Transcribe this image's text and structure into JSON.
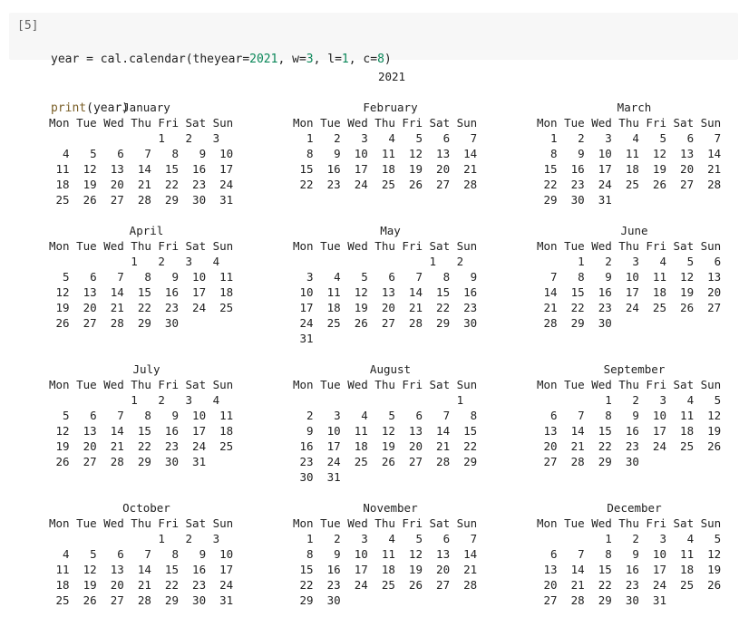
{
  "cell": {
    "prompt": "[5]",
    "line1": [
      {
        "t": "year = cal.calendar(theyear=",
        "c": ""
      },
      {
        "t": "2021",
        "c": "num"
      },
      {
        "t": ", w=",
        "c": ""
      },
      {
        "t": "3",
        "c": "num"
      },
      {
        "t": ", l=",
        "c": ""
      },
      {
        "t": "1",
        "c": "num"
      },
      {
        "t": ", c=",
        "c": ""
      },
      {
        "t": "8",
        "c": "num"
      },
      {
        "t": ")",
        "c": ""
      }
    ],
    "line2": [
      {
        "t": "print",
        "c": "kw"
      },
      {
        "t": "(year)",
        "c": ""
      }
    ]
  },
  "output": {
    "year_title": "2021",
    "weekday_header": "Mon Tue Wed Thu Fri Sat Sun",
    "months": [
      {
        "name": "January",
        "weeks": [
          "                1   2   3",
          "  4   5   6   7   8   9  10",
          " 11  12  13  14  15  16  17",
          " 18  19  20  21  22  23  24",
          " 25  26  27  28  29  30  31"
        ]
      },
      {
        "name": "February",
        "weeks": [
          "  1   2   3   4   5   6   7",
          "  8   9  10  11  12  13  14",
          " 15  16  17  18  19  20  21",
          " 22  23  24  25  26  27  28"
        ]
      },
      {
        "name": "March",
        "weeks": [
          "  1   2   3   4   5   6   7",
          "  8   9  10  11  12  13  14",
          " 15  16  17  18  19  20  21",
          " 22  23  24  25  26  27  28",
          " 29  30  31"
        ]
      },
      {
        "name": "April",
        "weeks": [
          "            1   2   3   4",
          "  5   6   7   8   9  10  11",
          " 12  13  14  15  16  17  18",
          " 19  20  21  22  23  24  25",
          " 26  27  28  29  30"
        ]
      },
      {
        "name": "May",
        "weeks": [
          "                    1   2",
          "  3   4   5   6   7   8   9",
          " 10  11  12  13  14  15  16",
          " 17  18  19  20  21  22  23",
          " 24  25  26  27  28  29  30",
          " 31"
        ]
      },
      {
        "name": "June",
        "weeks": [
          "      1   2   3   4   5   6",
          "  7   8   9  10  11  12  13",
          " 14  15  16  17  18  19  20",
          " 21  22  23  24  25  26  27",
          " 28  29  30"
        ]
      },
      {
        "name": "July",
        "weeks": [
          "            1   2   3   4",
          "  5   6   7   8   9  10  11",
          " 12  13  14  15  16  17  18",
          " 19  20  21  22  23  24  25",
          " 26  27  28  29  30  31"
        ]
      },
      {
        "name": "August",
        "weeks": [
          "                        1",
          "  2   3   4   5   6   7   8",
          "  9  10  11  12  13  14  15",
          " 16  17  18  19  20  21  22",
          " 23  24  25  26  27  28  29",
          " 30  31"
        ]
      },
      {
        "name": "September",
        "weeks": [
          "          1   2   3   4   5",
          "  6   7   8   9  10  11  12",
          " 13  14  15  16  17  18  19",
          " 20  21  22  23  24  25  26",
          " 27  28  29  30"
        ]
      },
      {
        "name": "October",
        "weeks": [
          "                1   2   3",
          "  4   5   6   7   8   9  10",
          " 11  12  13  14  15  16  17",
          " 18  19  20  21  22  23  24",
          " 25  26  27  28  29  30  31"
        ]
      },
      {
        "name": "November",
        "weeks": [
          "  1   2   3   4   5   6   7",
          "  8   9  10  11  12  13  14",
          " 15  16  17  18  19  20  21",
          " 22  23  24  25  26  27  28",
          " 29  30"
        ]
      },
      {
        "name": "December",
        "weeks": [
          "          1   2   3   4   5",
          "  6   7   8   9  10  11  12",
          " 13  14  15  16  17  18  19",
          " 20  21  22  23  24  25  26",
          " 27  28  29  30  31"
        ]
      }
    ]
  }
}
